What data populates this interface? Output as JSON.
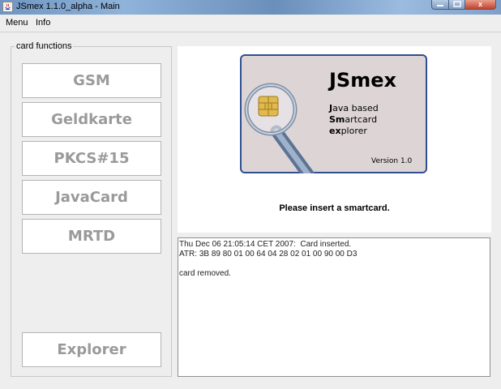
{
  "window": {
    "title": "JSmex 1.1.0_alpha - Main",
    "controls": {
      "close": "x"
    }
  },
  "menubar": {
    "items": [
      {
        "label": "Menu"
      },
      {
        "label": "Info"
      }
    ]
  },
  "card_functions": {
    "title": "card functions",
    "buttons": [
      {
        "label": "GSM"
      },
      {
        "label": "Geldkarte"
      },
      {
        "label": "PKCS#15"
      },
      {
        "label": "JavaCard"
      },
      {
        "label": "MRTD"
      }
    ],
    "explorer_label": "Explorer"
  },
  "logo": {
    "title": "JSmex",
    "tagline": [
      {
        "initial": "J",
        "rest": "ava based"
      },
      {
        "initial": "Sm",
        "rest": "artcard"
      },
      {
        "initial": "ex",
        "rest": "plorer"
      }
    ],
    "version": "Version 1.0"
  },
  "status_message": "Please insert a smartcard.",
  "log": {
    "lines": [
      "Thu Dec 06 21:05:14 CET 2007:  Card inserted.",
      "ATR: 3B 89 80 01 00 64 04 28 02 01 00 90 00 D3",
      "",
      "card removed."
    ]
  },
  "colors": {
    "button_text": "#9a9a9a",
    "card_face": "#ddd5d5",
    "card_border": "#2f4f90",
    "lens_handle": "#6f86a6"
  }
}
